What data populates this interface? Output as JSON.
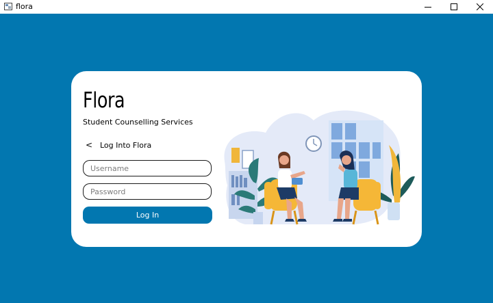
{
  "window": {
    "title": "flora"
  },
  "login": {
    "brand": "Flora",
    "subtitle": "Student Counselling Services",
    "back_glyph": "<",
    "back_label": "Log Into Flora",
    "username_placeholder": "Username",
    "password_placeholder": "Password",
    "login_label": "Log In"
  },
  "colors": {
    "background": "#0277b0",
    "button": "#0277b0",
    "card": "#ffffff"
  },
  "illustration": {
    "subject": "counselling-session"
  }
}
